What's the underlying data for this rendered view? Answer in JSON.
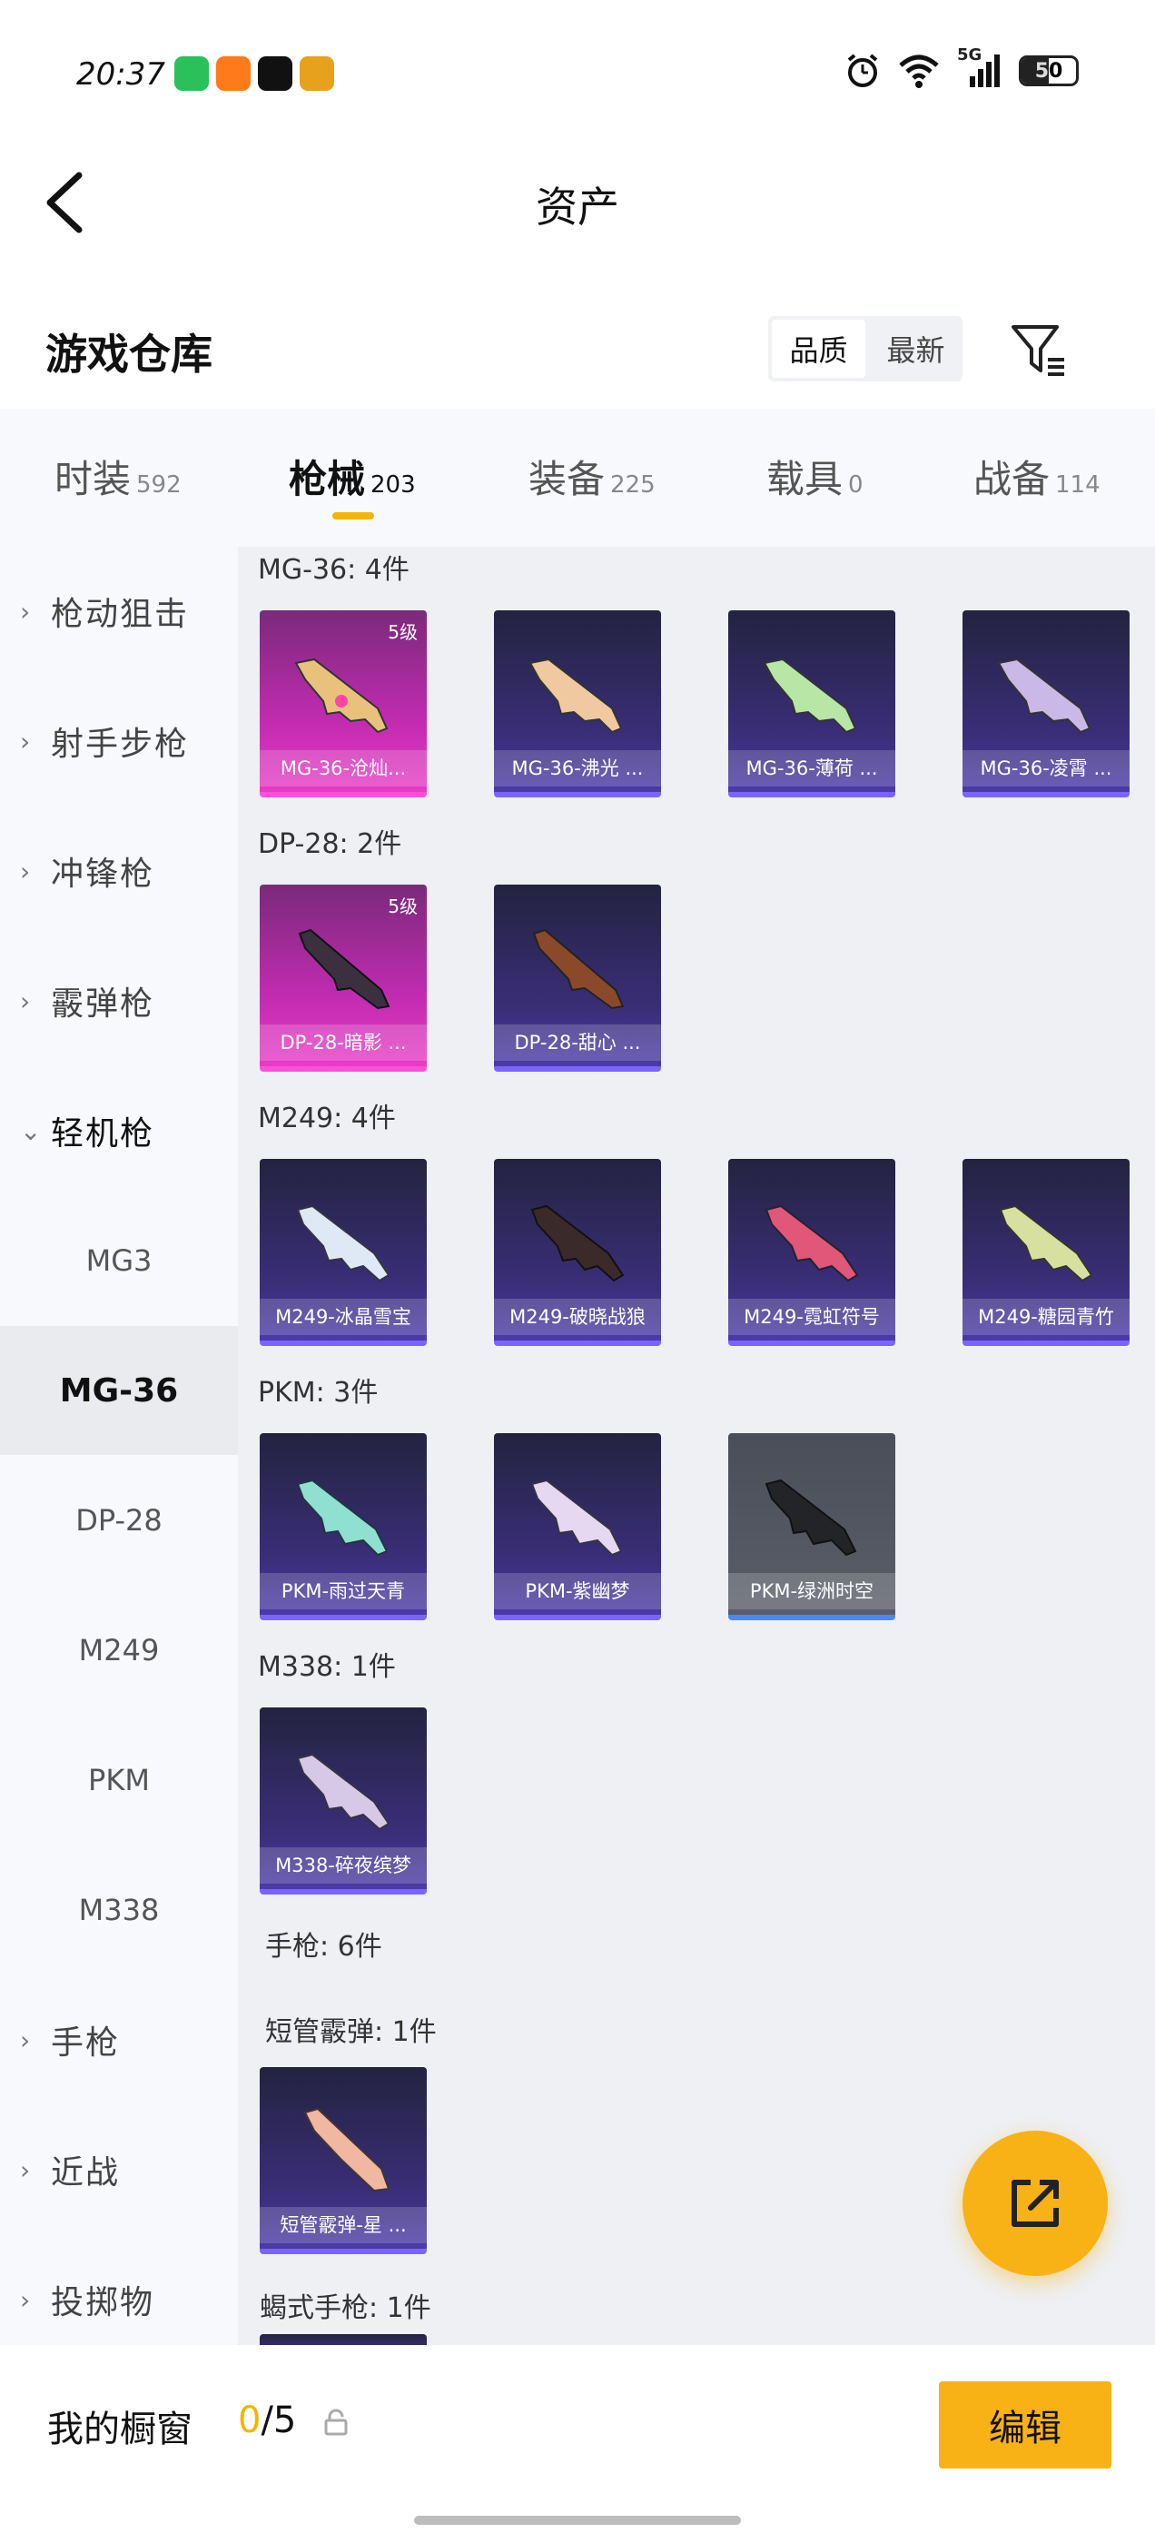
{
  "status_bar": {
    "time": "20:37",
    "network": "5G",
    "battery": "50",
    "battery_level": 0.5,
    "app_icons": [
      {
        "name": "wechat-app-icon",
        "color": "#2bc15a"
      },
      {
        "name": "taobao-flash-app-icon",
        "color": "#ff7a1a"
      },
      {
        "name": "tiktok-app-icon",
        "color": "#111111"
      },
      {
        "name": "peace-elite-app-icon",
        "color": "#e8a11c"
      }
    ]
  },
  "header": {
    "title": "资产"
  },
  "warehouse": {
    "title": "游戏仓库",
    "sort_options": [
      "品质",
      "最新"
    ],
    "active_sort": "品质"
  },
  "tabs": [
    {
      "label": "时装",
      "count": "592"
    },
    {
      "label": "枪械",
      "count": "203",
      "active": true
    },
    {
      "label": "装备",
      "count": "225"
    },
    {
      "label": "载具",
      "count": "0"
    },
    {
      "label": "战备",
      "count": "114"
    }
  ],
  "sidebar": {
    "categories": [
      "枪动狙击",
      "射手步枪",
      "冲锋枪",
      "霰弹枪",
      "轻机枪"
    ],
    "expanded_category": "轻机枪",
    "subitems": [
      "MG3",
      "MG-36",
      "DP-28",
      "M249",
      "PKM",
      "M338"
    ],
    "selected_subitem": "MG-36",
    "more_categories": [
      "手枪",
      "近战",
      "投掷物"
    ]
  },
  "groups": [
    {
      "title": "MG-36: 4件",
      "items": [
        {
          "name": "MG-36-沧灿...",
          "rarity": "pink",
          "level": "5级"
        },
        {
          "name": "MG-36-沸光 ...",
          "rarity": "purple"
        },
        {
          "name": "MG-36-薄荷 ...",
          "rarity": "purple"
        },
        {
          "name": "MG-36-凌霄 ...",
          "rarity": "purple"
        }
      ]
    },
    {
      "title": "DP-28: 2件",
      "items": [
        {
          "name": "DP-28-暗影 ...",
          "rarity": "pink",
          "level": "5级"
        },
        {
          "name": "DP-28-甜心 ...",
          "rarity": "purple"
        }
      ]
    },
    {
      "title": "M249: 4件",
      "items": [
        {
          "name": "M249-冰晶雪宝",
          "rarity": "purple"
        },
        {
          "name": "M249-破晓战狼",
          "rarity": "purple"
        },
        {
          "name": "M249-霓虹符号",
          "rarity": "purple"
        },
        {
          "name": "M249-糖园青竹",
          "rarity": "purple"
        }
      ]
    },
    {
      "title": "PKM: 3件",
      "items": [
        {
          "name": "PKM-雨过天青",
          "rarity": "purple"
        },
        {
          "name": "PKM-紫幽梦",
          "rarity": "purple"
        },
        {
          "name": "PKM-绿洲时空",
          "rarity": "grey"
        }
      ]
    },
    {
      "title": "M338: 1件",
      "items": [
        {
          "name": "M338-碎夜缤梦",
          "rarity": "purple"
        }
      ]
    }
  ],
  "pistol_section": {
    "title": "手枪: 6件",
    "subgroups": [
      {
        "title": "短管霰弹: 1件",
        "items": [
          {
            "name": "短管霰弹-星 ...",
            "rarity": "purple"
          }
        ]
      },
      {
        "title": "蝎式手枪: 1件"
      }
    ]
  },
  "bottom_bar": {
    "showcase_label": "我的橱窗",
    "showcase_current": "0",
    "showcase_total": "/5",
    "edit_label": "编辑"
  },
  "colors": {
    "accent": "#f8b216",
    "pink_rarity": "#e83bc6",
    "purple_rarity": "#4b3aa8"
  }
}
